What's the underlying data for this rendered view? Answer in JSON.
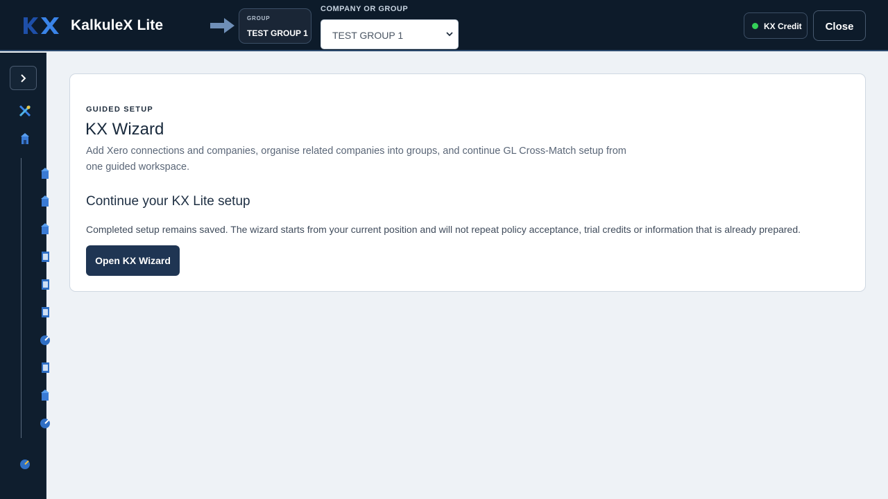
{
  "header": {
    "app_title": "KalkuleX Lite",
    "logo_text": "KX",
    "group_badge": {
      "label": "GROUP",
      "value": "TEST GROUP 1"
    },
    "company_selector": {
      "label": "COMPANY OR GROUP",
      "selected": "TEST GROUP 1"
    },
    "credit_button": {
      "label": "KX Credit",
      "status_color": "#34d058"
    },
    "close_button": {
      "label": "Close"
    }
  },
  "sidebar": {
    "expand_icon": "chevron-right-icon",
    "icons": [
      "kx-tools-icon",
      "building-icon",
      "building-icon",
      "building-icon",
      "building-icon",
      "document-icon",
      "document-icon",
      "document-icon",
      "gauge-icon",
      "document-icon",
      "building-icon",
      "gauge-icon",
      "gauge-icon"
    ]
  },
  "main": {
    "eyebrow": "GUIDED SETUP",
    "title": "KX Wizard",
    "description": "Add Xero connections and companies, organise related companies into groups, and continue GL Cross-Match setup from one guided workspace.",
    "section_title": "Continue your KX Lite setup",
    "section_text": "Completed setup remains saved. The wizard starts from your current position and will not repeat policy acceptance, trial credits or information that is already prepared.",
    "cta_label": "Open KX Wizard"
  },
  "colors": {
    "header_bg": "#0d1b2a",
    "sidebar_bg": "#0f1e2e",
    "page_bg": "#eef2f6",
    "primary_button": "#1f3553",
    "logo_blue": "#2f6fd6"
  }
}
